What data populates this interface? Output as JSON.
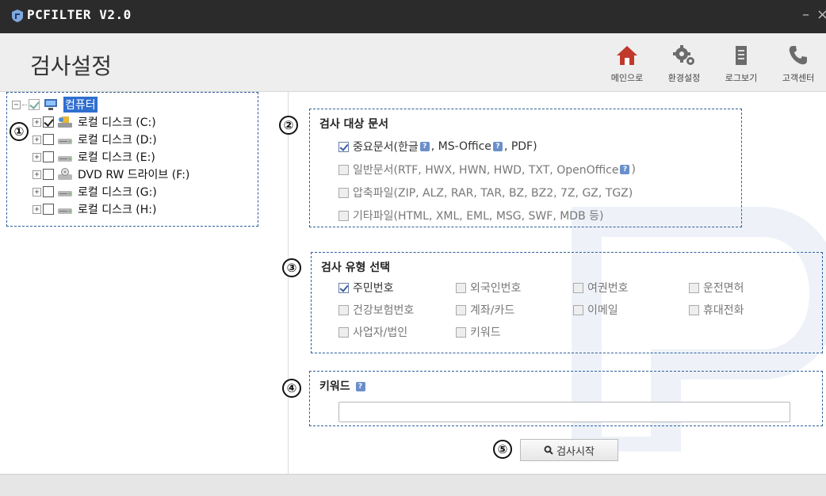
{
  "window": {
    "title": "PCFILTER V2.0",
    "minimize": "–",
    "close": "×"
  },
  "header": {
    "page_title": "검사설정",
    "toolbar": [
      {
        "label": "메인으로",
        "icon": "home-icon",
        "color": "#c0392b"
      },
      {
        "label": "환경설정",
        "icon": "gear-icon",
        "color": "#6b6b6b"
      },
      {
        "label": "로그보기",
        "icon": "log-icon",
        "color": "#6b6b6b"
      },
      {
        "label": "고객센터",
        "icon": "phone-icon",
        "color": "#6b6b6b"
      }
    ]
  },
  "badges": [
    "①",
    "②",
    "③",
    "④",
    "⑤"
  ],
  "tree": {
    "root": {
      "label": "컴퓨터",
      "checked": true
    },
    "drives": [
      {
        "label": "로컬 디스크 (C:)",
        "checked": true,
        "icon": "system-drive-icon"
      },
      {
        "label": "로컬 디스크 (D:)",
        "checked": false,
        "icon": "hard-drive-icon"
      },
      {
        "label": "로컬 디스크 (E:)",
        "checked": false,
        "icon": "hard-drive-icon"
      },
      {
        "label": "DVD RW 드라이브 (F:)",
        "checked": false,
        "icon": "dvd-drive-icon"
      },
      {
        "label": "로컬 디스크 (G:)",
        "checked": false,
        "icon": "hard-drive-icon"
      },
      {
        "label": "로컬 디스크 (H:)",
        "checked": false,
        "icon": "hard-drive-icon"
      }
    ]
  },
  "target_docs": {
    "title": "검사 대상 문서",
    "items": [
      {
        "parts": [
          "중요문서(한글",
          ", MS-Office",
          ", PDF)"
        ],
        "help_count": 2,
        "checked": true
      },
      {
        "parts": [
          "일반문서(RTF, HWX, HWN, HWD, TXT, OpenOffice",
          ")"
        ],
        "help_count": 1,
        "checked": false
      },
      {
        "parts": [
          "압축파일(ZIP, ALZ, RAR, TAR, BZ, BZ2, 7Z, GZ, TGZ)"
        ],
        "help_count": 0,
        "checked": false
      },
      {
        "parts": [
          "기타파일(HTML, XML, EML, MSG, SWF, MDB 등)"
        ],
        "help_count": 0,
        "checked": false
      }
    ]
  },
  "scan_types": {
    "title": "검사 유형 선택",
    "items": [
      {
        "label": "주민번호",
        "checked": true
      },
      {
        "label": "외국인번호",
        "checked": false
      },
      {
        "label": "여권번호",
        "checked": false
      },
      {
        "label": "운전면허",
        "checked": false
      },
      {
        "label": "건강보험번호",
        "checked": false
      },
      {
        "label": "계좌/카드",
        "checked": false
      },
      {
        "label": "이메일",
        "checked": false
      },
      {
        "label": "휴대전화",
        "checked": false
      },
      {
        "label": "사업자/법인",
        "checked": false
      },
      {
        "label": "키워드",
        "checked": false
      }
    ]
  },
  "keyword": {
    "title": "키워드",
    "value": "",
    "placeholder": ""
  },
  "scan_button": {
    "label": "검사시작",
    "icon": "search-icon"
  },
  "colors": {
    "titlebar": "#2b2b2b",
    "header": "#eeeeee",
    "accent": "#2f6fcf",
    "home": "#c0392b",
    "dashed_border": "#2e5f9a"
  }
}
